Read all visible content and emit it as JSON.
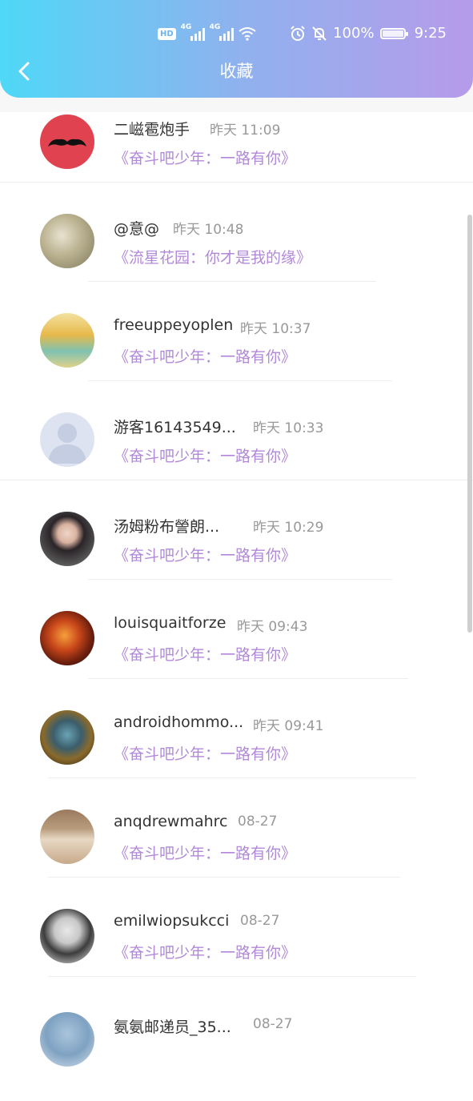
{
  "status_bar": {
    "hd": "HD",
    "net1": "4G",
    "net2": "4G",
    "battery_percent": "100%",
    "time": "9:25"
  },
  "header": {
    "title": "收藏",
    "back_icon": "chevron-left-icon"
  },
  "items": [
    {
      "name": "二嵫雹炮手",
      "time": "昨天 11:09",
      "favorite": "《奋斗吧少年：一路有你》",
      "avatar": "mustache"
    },
    {
      "name": "@意@",
      "time": "昨天 10:48",
      "favorite": "《流星花园：你才是我的缘》",
      "avatar": "photo-couple"
    },
    {
      "name": "freeuppeyoplen",
      "time": "昨天 10:37",
      "favorite": "《奋斗吧少年：一路有你》",
      "avatar": "photo-beach"
    },
    {
      "name": "游客16143549...",
      "time": "昨天 10:33",
      "favorite": "《奋斗吧少年：一路有你》",
      "avatar": "default-user"
    },
    {
      "name": "汤姆粉布謍朗...",
      "time": "昨天 10:29",
      "favorite": "《奋斗吧少年：一路有你》",
      "avatar": "photo-girl"
    },
    {
      "name": "louisquaitforze",
      "time": "昨天 09:43",
      "favorite": "《奋斗吧少年：一路有你》",
      "avatar": "photo-leaves"
    },
    {
      "name": "androidhommo...",
      "time": "昨天 09:41",
      "favorite": "《奋斗吧少年：一路有你》",
      "avatar": "photo-art"
    },
    {
      "name": "anqdrewmahrc",
      "time": "08-27",
      "favorite": "《奋斗吧少年：一路有你》",
      "avatar": "photo-park"
    },
    {
      "name": "emilwiopsukcci",
      "time": "08-27",
      "favorite": "《奋斗吧少年：一路有你》",
      "avatar": "photo-bw"
    },
    {
      "name": "氨氨邮递员_35...",
      "time": "08-27",
      "favorite": "",
      "avatar": "photo-blue"
    }
  ]
}
